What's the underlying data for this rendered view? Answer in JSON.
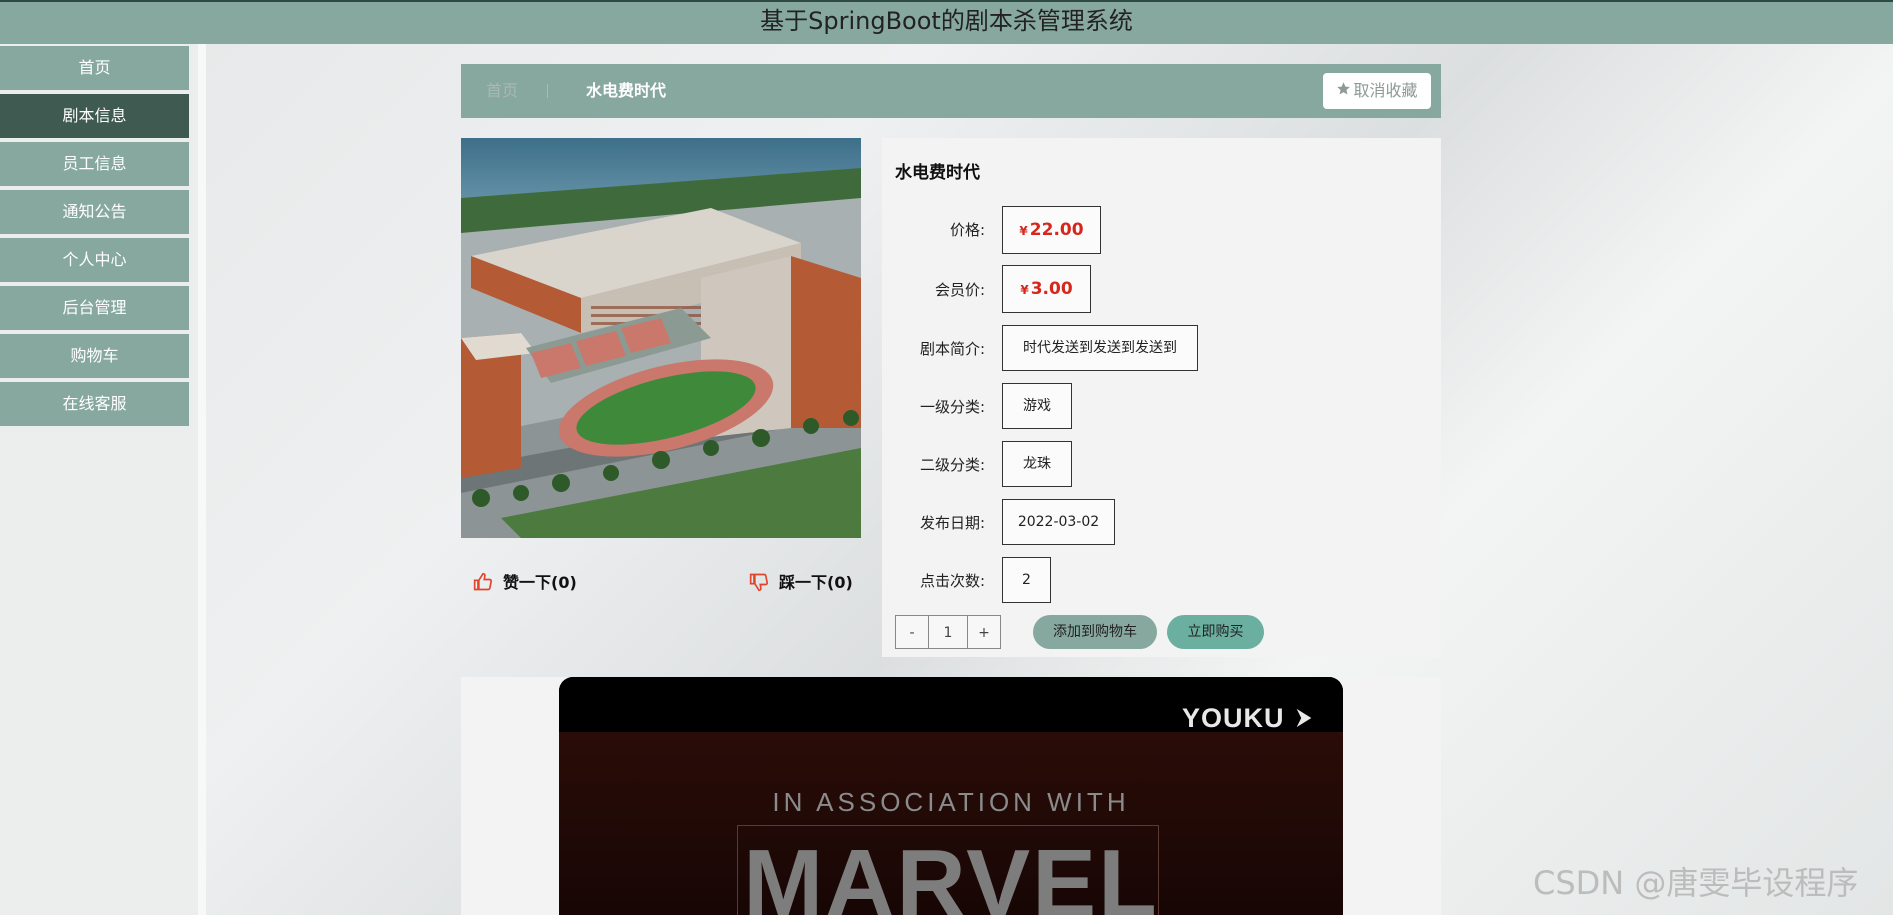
{
  "header": {
    "title": "基于SpringBoot的剧本杀管理系统"
  },
  "sidebar": {
    "items": [
      {
        "label": "首页",
        "active": false
      },
      {
        "label": "剧本信息",
        "active": true
      },
      {
        "label": "员工信息",
        "active": false
      },
      {
        "label": "通知公告",
        "active": false
      },
      {
        "label": "个人中心",
        "active": false
      },
      {
        "label": "后台管理",
        "active": false
      },
      {
        "label": "购物车",
        "active": false
      },
      {
        "label": "在线客服",
        "active": false
      }
    ]
  },
  "breadcrumb": {
    "home": "首页",
    "current": "水电费时代"
  },
  "favorite": {
    "label": "取消收藏",
    "icon": "star-icon"
  },
  "votes": {
    "like": {
      "label": "赞一下(0)",
      "icon": "thumbs-up-icon"
    },
    "dislike": {
      "label": "踩一下(0)",
      "icon": "thumbs-down-icon"
    }
  },
  "product": {
    "title": "水电费时代",
    "currency": "¥",
    "price_label": "价格:",
    "price": "22.00",
    "member_price_label": "会员价:",
    "member_price": "3.00",
    "intro_label": "剧本简介:",
    "intro": "时代发送到发送到发送到",
    "cat1_label": "一级分类:",
    "cat1": "游戏",
    "cat2_label": "二级分类:",
    "cat2": "龙珠",
    "date_label": "发布日期:",
    "date": "2022-03-02",
    "clicks_label": "点击次数:",
    "clicks": "2"
  },
  "cart": {
    "minus": "-",
    "quantity": "1",
    "plus": "+",
    "add_label": "添加到购物车",
    "buy_label": "立即购买"
  },
  "video": {
    "brand": "YOUKU",
    "line1": "IN ASSOCIATION WITH",
    "line2": "MARVEL"
  },
  "watermark": "CSDN @唐雯毕设程序",
  "colors": {
    "primary": "#87a89e",
    "active": "#3e5a51",
    "price": "#d7261b",
    "buy": "#6aaf9f"
  }
}
